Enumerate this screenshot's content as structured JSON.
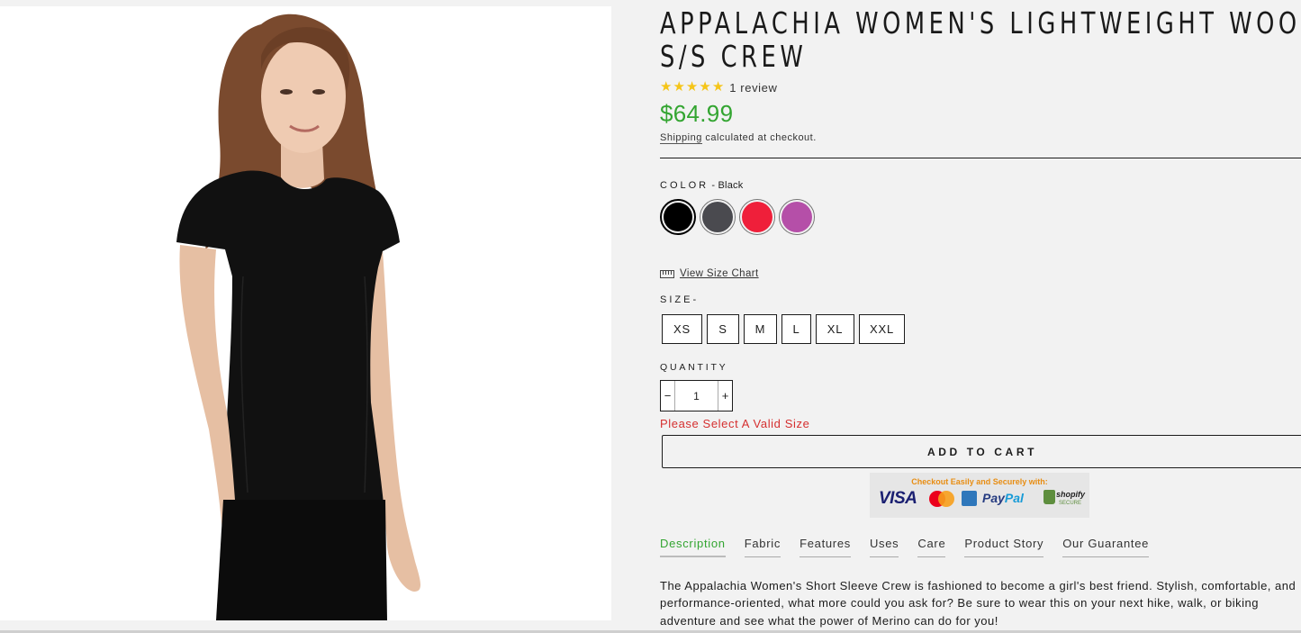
{
  "product": {
    "title_line1": "Appalachia Women's Lightweight Wool",
    "title_line2": "S/S Crew",
    "rating": 5,
    "stars": [
      "★",
      "★",
      "★",
      "★",
      "★"
    ],
    "review_count": "1 review",
    "price": "$64.99",
    "shipping_link": "Shipping",
    "shipping_suffix": " calculated at checkout.",
    "image_alt": "Woman wearing black short sleeve crew"
  },
  "color": {
    "label": "COLOR",
    "separator": " - ",
    "selected": "Black",
    "options": [
      {
        "name": "Black",
        "hex": "#000000"
      },
      {
        "name": "Charcoal",
        "hex": "#4a4a4f"
      },
      {
        "name": "Red",
        "hex": "#ef1f3a"
      },
      {
        "name": "Purple",
        "hex": "#b54fa8"
      }
    ]
  },
  "size_chart": {
    "label": "View Size Chart"
  },
  "size": {
    "label": "SIZE-",
    "options": [
      "XS",
      "S",
      "M",
      "L",
      "XL",
      "XXL"
    ]
  },
  "quantity": {
    "label": "QUANTITY",
    "minus": "−",
    "value": "1",
    "plus": "+"
  },
  "error": "Please Select A Valid Size",
  "cart": {
    "label": "ADD TO CART"
  },
  "trust_badge": {
    "heading": "Checkout Easily and Securely with:",
    "visa": "VISA",
    "paypal_a": "Pay",
    "paypal_b": "Pal",
    "shopify": "shopify",
    "secure": "SECURE"
  },
  "tabs": [
    "Description",
    "Fabric",
    "Features",
    "Uses",
    "Care",
    "Product Story",
    "Our Guarantee"
  ],
  "active_tab": "Description",
  "description": "The Appalachia Women's Short Sleeve Crew is fashioned to become a girl's best friend. Stylish, comfortable, and performance-oriented, what more could you ask for? Be sure to wear this on your next hike, walk, or biking adventure and see what the power of Merino can do for you!",
  "colors": {
    "accent": "#33a531",
    "error": "#d52f2f",
    "star": "#f5c518"
  }
}
